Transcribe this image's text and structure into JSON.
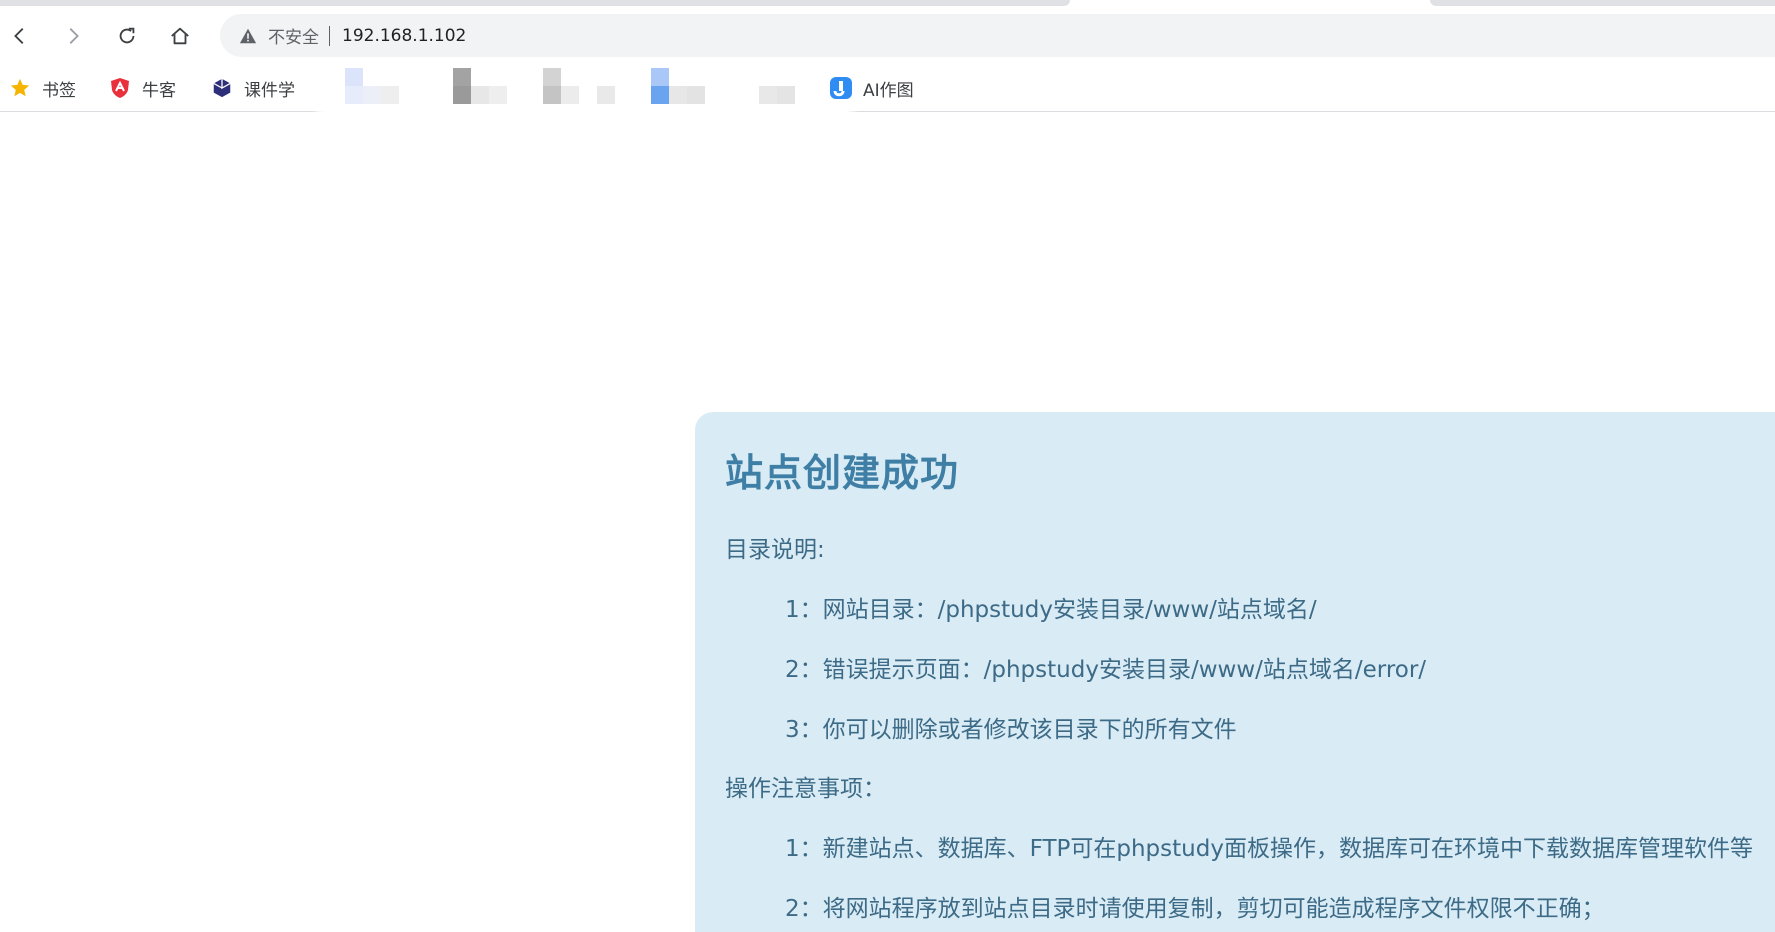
{
  "browser": {
    "security_label": "不安全",
    "url": "192.168.1.102",
    "nav": {
      "back_icon": "chevron-left-icon",
      "forward_icon": "chevron-right-icon",
      "reload_icon": "reload-icon",
      "home_icon": "home-icon"
    }
  },
  "bookmarks": [
    {
      "label": "书签",
      "icon": "star-icon"
    },
    {
      "label": "牛客",
      "icon": "nowcoder-shield-icon"
    },
    {
      "label": "课件学",
      "icon": "cube-icon"
    },
    {
      "label": "AI作图",
      "icon": "ai-app-icon"
    }
  ],
  "page": {
    "title": "站点创建成功",
    "dir_heading": "目录说明:",
    "dir_items": [
      "1：网站目录：/phpstudy安装目录/www/站点域名/",
      "2：错误提示页面：/phpstudy安装目录/www/站点域名/error/",
      "3：你可以删除或者修改该目录下的所有文件"
    ],
    "ops_heading": "操作注意事项：",
    "ops_items": [
      "1：新建站点、数据库、FTP可在phpstudy面板操作，数据库可在环境中下载数据库管理软件等",
      "2：将网站程序放到站点目录时请使用复制，剪切可能造成程序文件权限不正确；"
    ]
  },
  "colors": {
    "card_bg": "#d9ecf5",
    "title": "#3f7fa6",
    "body_text": "#3d6a86"
  }
}
